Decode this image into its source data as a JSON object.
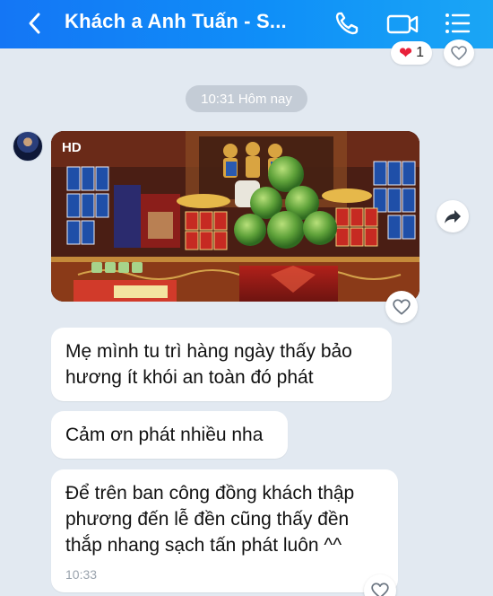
{
  "header": {
    "title": "Khách a Anh  Tuấn - S...",
    "icons": [
      "back-chevron-icon",
      "phone-icon",
      "video-call-icon",
      "menu-list-icon"
    ]
  },
  "prev_reaction": {
    "emoji": "❤",
    "count": "1"
  },
  "time_separator": "10:31 Hôm nay",
  "photo": {
    "badge": "HD"
  },
  "messages": [
    {
      "lines": [
        "Mẹ mình tu trì hàng ngày thấy bảo",
        "hương ít khói an toàn đó phát"
      ]
    },
    {
      "lines": [
        "Cảm ơn phát nhiều nha"
      ]
    },
    {
      "lines": [
        "Để trên ban công đồng khách thập",
        "phương đến lễ đền cũng thấy đền",
        "thắp nhang sạch tấn phát luôn ^^"
      ],
      "time": "10:33"
    }
  ],
  "colors": {
    "header": "#1476f5",
    "background": "#e2e9f1",
    "reaction": "#e8213a"
  }
}
